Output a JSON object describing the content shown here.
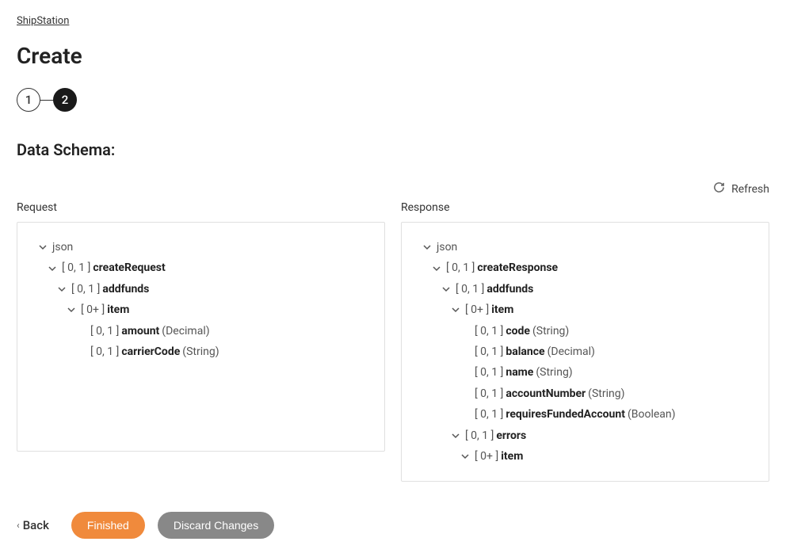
{
  "breadcrumb": "ShipStation",
  "page_title": "Create",
  "stepper": {
    "step1": "1",
    "step2": "2"
  },
  "section_title": "Data Schema:",
  "refresh_label": "Refresh",
  "request_header": "Request",
  "response_header": "Response",
  "request_tree": {
    "root": "json",
    "l1_card": "[ 0, 1 ]",
    "l1_name": "createRequest",
    "l2_card": "[ 0, 1 ]",
    "l2_name": "addfunds",
    "l3_card": "[ 0+ ]",
    "l3_name": "item",
    "f1_card": "[ 0, 1 ]",
    "f1_name": "amount",
    "f1_type": "(Decimal)",
    "f2_card": "[ 0, 1 ]",
    "f2_name": "carrierCode",
    "f2_type": "(String)"
  },
  "response_tree": {
    "root": "json",
    "l1_card": "[ 0, 1 ]",
    "l1_name": "createResponse",
    "l2_card": "[ 0, 1 ]",
    "l2_name": "addfunds",
    "l3_card": "[ 0+ ]",
    "l3_name": "item",
    "f1_card": "[ 0, 1 ]",
    "f1_name": "code",
    "f1_type": "(String)",
    "f2_card": "[ 0, 1 ]",
    "f2_name": "balance",
    "f2_type": "(Decimal)",
    "f3_card": "[ 0, 1 ]",
    "f3_name": "name",
    "f3_type": "(String)",
    "f4_card": "[ 0, 1 ]",
    "f4_name": "accountNumber",
    "f4_type": "(String)",
    "f5_card": "[ 0, 1 ]",
    "f5_name": "requiresFundedAccount",
    "f5_type": "(Boolean)",
    "e_card": "[ 0, 1 ]",
    "e_name": "errors",
    "ei_card": "[ 0+ ]",
    "ei_name": "item"
  },
  "footer": {
    "back": "Back",
    "finished": "Finished",
    "discard": "Discard Changes"
  }
}
